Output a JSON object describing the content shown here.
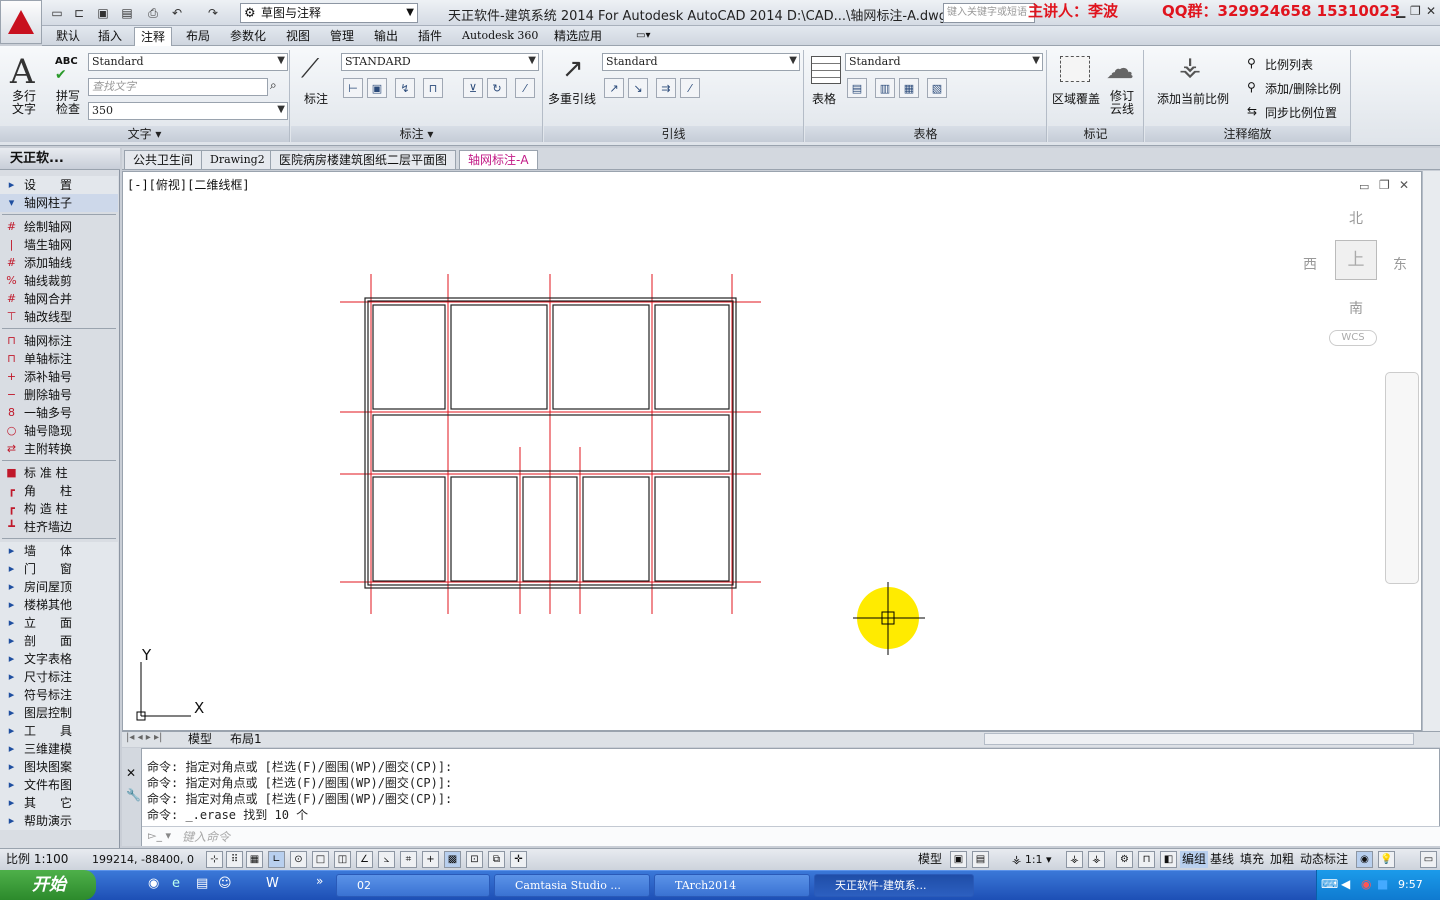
{
  "titlebar": {
    "workspace": "草图与注释",
    "title": "天正软件-建筑系统 2014  For Autodesk AutoCAD 2014    D:\\CAD...\\轴网标注-A.dwg",
    "search_placeholder": "键入关键字或短语",
    "lecturer": "主讲人：李波",
    "qq": "QQ群：329924658   15310023"
  },
  "menu": [
    "默认",
    "插入",
    "注释",
    "布局",
    "参数化",
    "视图",
    "管理",
    "输出",
    "插件",
    "Autodesk 360",
    "精选应用"
  ],
  "ribbon": {
    "text_panel": {
      "title": "文字",
      "big_button": "多行\n文字",
      "spell": "拼写\n检查",
      "style": "Standard",
      "find_placeholder": "查找文字",
      "height": "350"
    },
    "dim_panel": {
      "title": "标注",
      "big_button": "标注",
      "style": "STANDARD"
    },
    "leader_panel": {
      "title": "引线",
      "big_button": "多重引线",
      "style": "Standard"
    },
    "table_panel": {
      "title": "表格",
      "big_button": "表格",
      "style": "Standard"
    },
    "mark_panel": {
      "title": "标记",
      "wipeout": "区域覆盖",
      "revcloud": "修订\n云线"
    },
    "scale_panel": {
      "title": "注释缩放",
      "add_current": "添加当前比例",
      "scale_list": "比例列表",
      "add_delete": "添加/删除比例",
      "sync": "同步比例位置"
    }
  },
  "palette": {
    "title": "天正软...",
    "items": [
      {
        "label": "设　　置",
        "type": "group"
      },
      {
        "label": "轴网柱子",
        "type": "expanded"
      },
      {
        "label": "绘制轴网",
        "type": "sub",
        "icon": "#"
      },
      {
        "label": "墙生轴网",
        "type": "sub",
        "icon": "|"
      },
      {
        "label": "添加轴线",
        "type": "sub",
        "icon": "#"
      },
      {
        "label": "轴线裁剪",
        "type": "sub",
        "icon": "%"
      },
      {
        "label": "轴网合并",
        "type": "sub",
        "icon": "#"
      },
      {
        "label": "轴改线型",
        "type": "sub",
        "icon": "⊤"
      },
      {
        "label": "轴网标注",
        "type": "sub",
        "icon": "⊓"
      },
      {
        "label": "单轴标注",
        "type": "sub",
        "icon": "⊓"
      },
      {
        "label": "添补轴号",
        "type": "sub",
        "icon": "+"
      },
      {
        "label": "删除轴号",
        "type": "sub",
        "icon": "−"
      },
      {
        "label": "一轴多号",
        "type": "sub",
        "icon": "8"
      },
      {
        "label": "轴号隐现",
        "type": "sub",
        "icon": "○"
      },
      {
        "label": "主附转换",
        "type": "sub",
        "icon": "⇄"
      },
      {
        "label": "标 准 柱",
        "type": "sub",
        "icon": "■"
      },
      {
        "label": "角　　柱",
        "type": "sub",
        "icon": "┏"
      },
      {
        "label": "构 造 柱",
        "type": "sub",
        "icon": "┏"
      },
      {
        "label": "柱齐墙边",
        "type": "sub",
        "icon": "┻"
      },
      {
        "label": "墙　　体",
        "type": "group"
      },
      {
        "label": "门　　窗",
        "type": "group"
      },
      {
        "label": "房间屋顶",
        "type": "group"
      },
      {
        "label": "楼梯其他",
        "type": "group"
      },
      {
        "label": "立　　面",
        "type": "group"
      },
      {
        "label": "剖　　面",
        "type": "group"
      },
      {
        "label": "文字表格",
        "type": "group"
      },
      {
        "label": "尺寸标注",
        "type": "group"
      },
      {
        "label": "符号标注",
        "type": "group"
      },
      {
        "label": "图层控制",
        "type": "group"
      },
      {
        "label": "工　　具",
        "type": "group"
      },
      {
        "label": "三维建模",
        "type": "group"
      },
      {
        "label": "图块图案",
        "type": "group"
      },
      {
        "label": "文件布图",
        "type": "group"
      },
      {
        "label": "其　　它",
        "type": "group"
      },
      {
        "label": "帮助演示",
        "type": "group"
      }
    ]
  },
  "doc_tabs": [
    "公共卫生间",
    "Drawing2",
    "医院病房楼建筑图纸二层平面图",
    "轴网标注-A"
  ],
  "viewport_label": "[-][俯视][二维线框]",
  "viewcube": {
    "north": "北",
    "south": "南",
    "east": "东",
    "west": "西",
    "top": "上",
    "wcs": "WCS"
  },
  "ucs": {
    "x": "X",
    "y": "Y"
  },
  "layout_tabs": [
    "模型",
    "布局1"
  ],
  "command": {
    "lines": [
      "命令: 指定对角点或 [栏选(F)/圈围(WP)/圈交(CP)]:",
      "命令: 指定对角点或 [栏选(F)/圈围(WP)/圈交(CP)]:",
      "命令: 指定对角点或 [栏选(F)/圈围(WP)/圈交(CP)]:",
      "命令: _.erase 找到 10 个"
    ],
    "placeholder": "键入命令"
  },
  "status": {
    "scale": "比例 1:100",
    "coords": "199214, -88400, 0",
    "model": "模型",
    "anno_scale": "1:1",
    "buttons": [
      "编组",
      "基线",
      "填充",
      "加粗",
      "动态标注"
    ]
  },
  "taskbar": {
    "start": "开始",
    "tasks": [
      "02",
      "Camtasia Studio ...",
      "TArch2014",
      "天正软件-建筑系..."
    ],
    "clock": "9:57"
  },
  "colors": {
    "axis": "#e0141e",
    "wall": "#222222",
    "accent": "#c8101e",
    "cursor": "#ffeb00"
  }
}
